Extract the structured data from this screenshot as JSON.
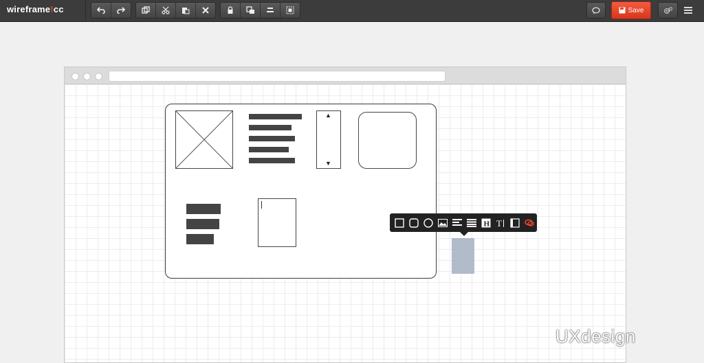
{
  "app": {
    "logo_main": "wireframe",
    "logo_bang": "!",
    "logo_tail": "cc"
  },
  "toolbar": {
    "groups": [
      [
        "undo-icon",
        "redo-icon"
      ],
      [
        "duplicate-icon",
        "cut-icon",
        "paste-icon",
        "delete-icon"
      ],
      [
        "lock-icon",
        "arrange-icon",
        "align-icon",
        "group-icon"
      ]
    ],
    "comment_icon": "comment-icon",
    "save_label": "Save",
    "save_icon": "floppy-icon",
    "settings_icon": "gears-icon",
    "menu_icon": "hamburger-icon"
  },
  "colors": {
    "topbar": "#3c3c3c",
    "save": "#e8452c",
    "element": "#444444",
    "selection": "#aab4c3"
  },
  "stencil_popup": {
    "items": [
      "rectangle-icon",
      "rounded-rectangle-icon",
      "circle-icon",
      "image-icon",
      "text-lines-icon",
      "list-icon",
      "heading-icon",
      "text-icon",
      "browser-window-icon",
      "comment-bubble-icon"
    ]
  },
  "watermark": "UXdesign"
}
